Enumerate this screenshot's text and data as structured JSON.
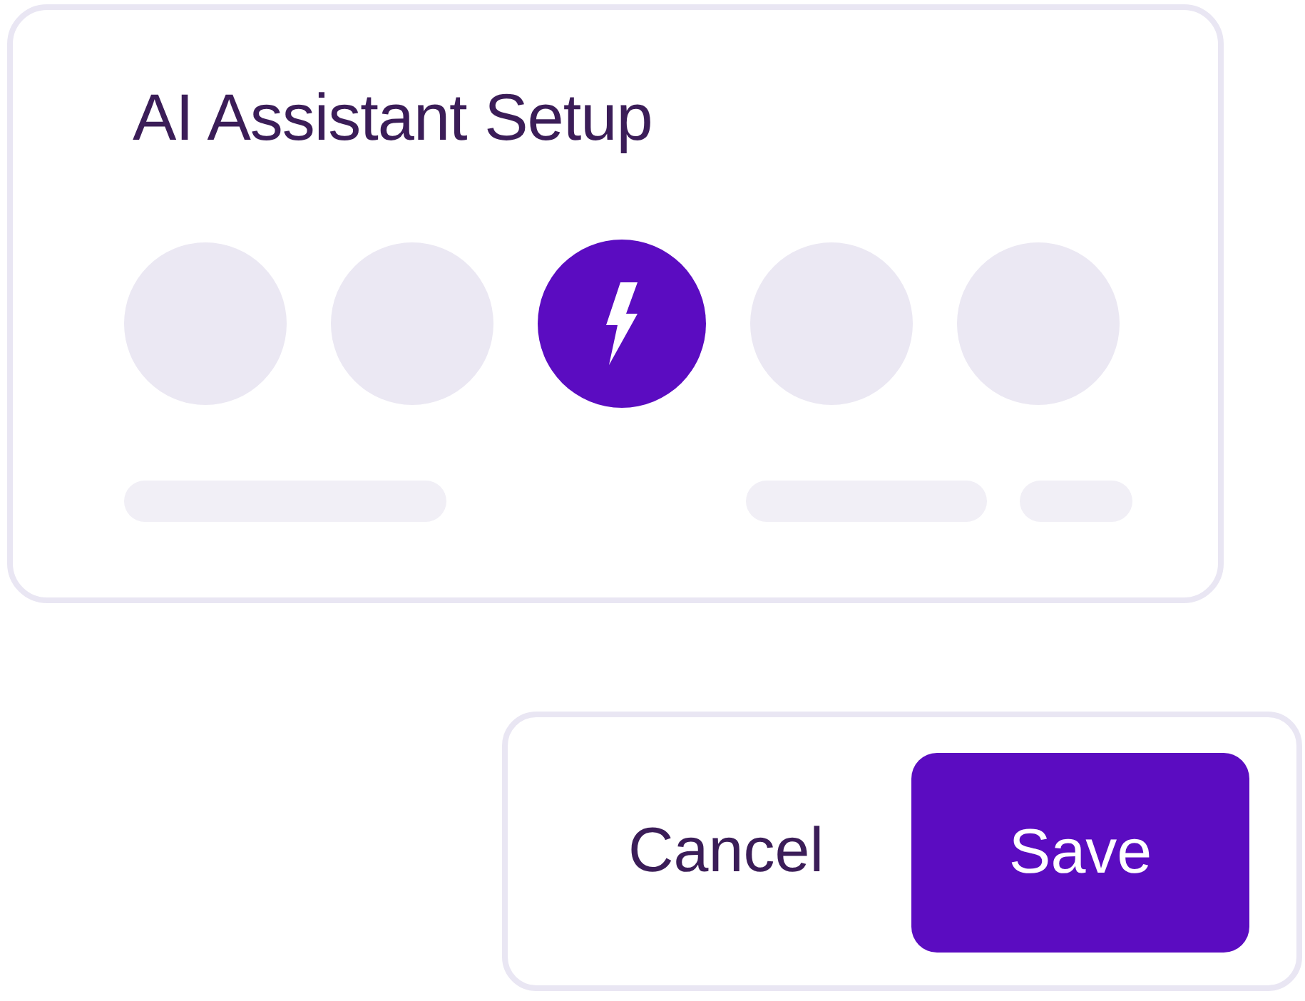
{
  "title": "AI Assistant Setup",
  "steps": [
    {
      "selected": false
    },
    {
      "selected": false
    },
    {
      "selected": true
    },
    {
      "selected": false
    },
    {
      "selected": false
    }
  ],
  "buttons": [
    {
      "label": "Cancel",
      "kind": "secondary"
    },
    {
      "label": "Save",
      "kind": "primary"
    }
  ]
}
